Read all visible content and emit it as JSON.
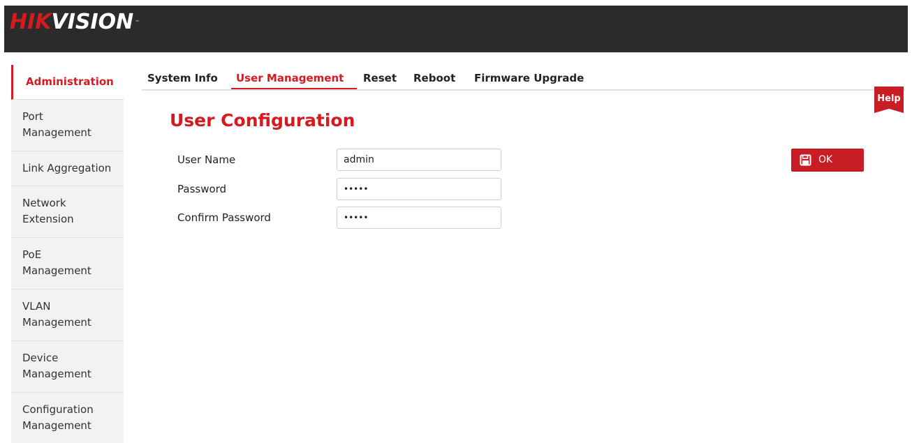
{
  "header": {
    "logo_part1": "HIK",
    "logo_part2": "VISION",
    "logo_tm": "™"
  },
  "sidebar": {
    "items": [
      {
        "label": "Administration",
        "active": true
      },
      {
        "label": "Port Management"
      },
      {
        "label": "Link Aggregation"
      },
      {
        "label": "Network Extension"
      },
      {
        "label": "PoE Management"
      },
      {
        "label": "VLAN Management"
      },
      {
        "label": "Device Management"
      },
      {
        "label": "Configuration Management"
      }
    ]
  },
  "tabs": [
    {
      "label": "System Info"
    },
    {
      "label": "User Management",
      "active": true
    },
    {
      "label": "Reset"
    },
    {
      "label": "Reboot"
    },
    {
      "label": "Firmware Upgrade"
    }
  ],
  "help_label": "Help",
  "main": {
    "title": "User Configuration",
    "fields": [
      {
        "label": "User Name",
        "value": "admin"
      },
      {
        "label": "Password",
        "value": "•••••"
      },
      {
        "label": "Confirm Password",
        "value": "•••••"
      }
    ],
    "ok_label": "OK",
    "ok_icon": "save-icon"
  },
  "colors": {
    "accent": "#d71920",
    "header_bg": "#2b2b2b",
    "sidebar_bg": "#f2f2f2"
  }
}
